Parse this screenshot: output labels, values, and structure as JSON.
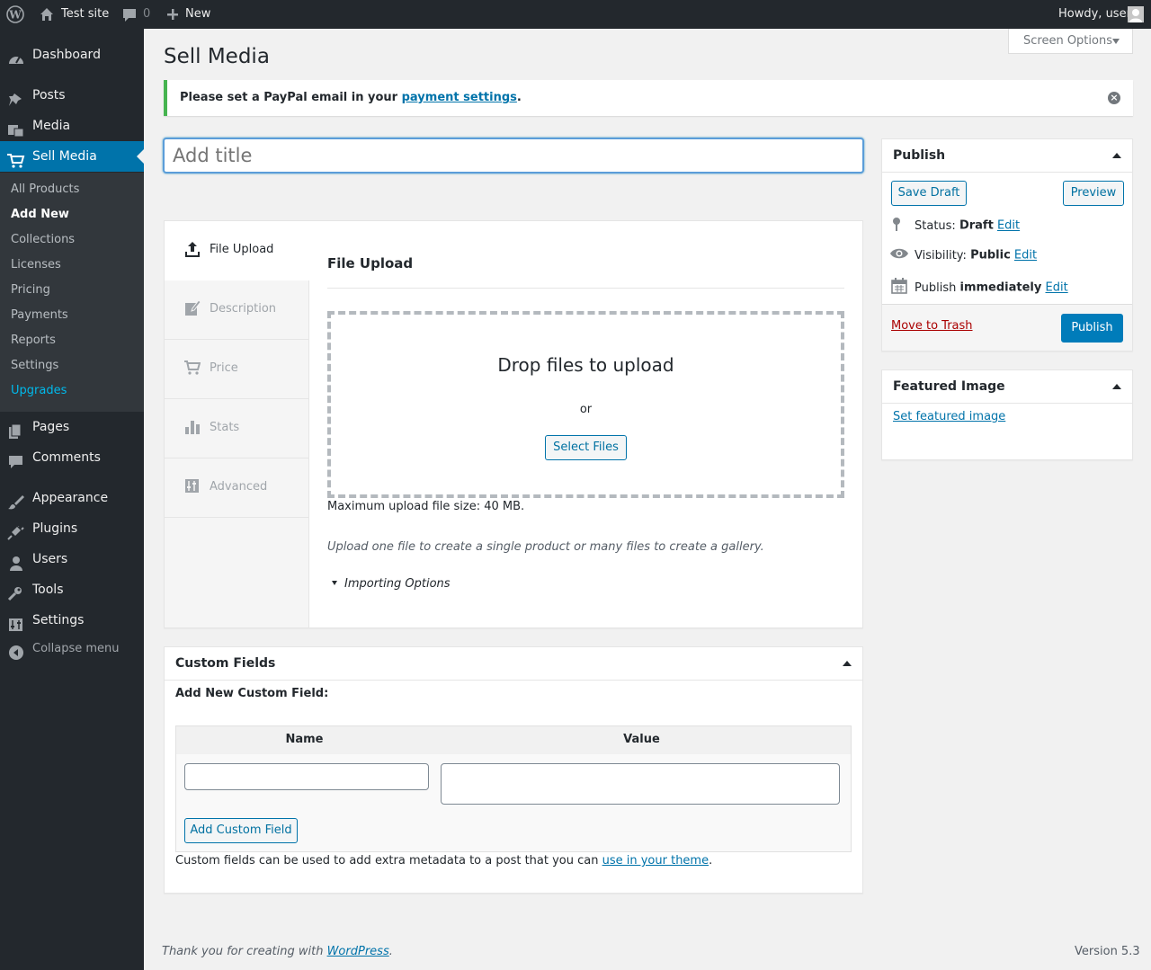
{
  "admin_bar": {
    "site_name": "Test site",
    "comments_count": "0",
    "new_label": "New",
    "greeting": "Howdy, user"
  },
  "sidebar": {
    "items": [
      {
        "label": "Dashboard",
        "icon": "dashboard-icon"
      },
      {
        "label": "Posts",
        "icon": "pin-icon"
      },
      {
        "label": "Media",
        "icon": "media-icon"
      },
      {
        "label": "Sell Media",
        "icon": "cart-icon"
      },
      {
        "label": "Pages",
        "icon": "page-icon"
      },
      {
        "label": "Comments",
        "icon": "comment-icon"
      },
      {
        "label": "Appearance",
        "icon": "brush-icon"
      },
      {
        "label": "Plugins",
        "icon": "plug-icon"
      },
      {
        "label": "Users",
        "icon": "user-icon"
      },
      {
        "label": "Tools",
        "icon": "wrench-icon"
      },
      {
        "label": "Settings",
        "icon": "settings-icon"
      }
    ],
    "submenu": [
      "All Products",
      "Add New",
      "Collections",
      "Licenses",
      "Pricing",
      "Payments",
      "Reports",
      "Settings",
      "Upgrades"
    ],
    "collapse_label": "Collapse menu"
  },
  "page": {
    "title": "Sell Media",
    "screen_options": "Screen Options",
    "notice_text": "Please set a PayPal email in your ",
    "notice_link": "payment settings",
    "notice_end": ".",
    "title_placeholder": "Add title"
  },
  "editor": {
    "tabs": [
      "File Upload",
      "Description",
      "Price",
      "Stats",
      "Advanced"
    ],
    "section_title": "File Upload",
    "drop_text": "Drop files to upload",
    "or_text": "or",
    "select_files": "Select Files",
    "max_size": "Maximum upload file size: 40 MB.",
    "help_text": "Upload one file to create a single product or many files to create a gallery.",
    "importing_options": "Importing Options"
  },
  "custom_fields": {
    "title": "Custom Fields",
    "add_new_label": "Add New Custom Field:",
    "col_name": "Name",
    "col_value": "Value",
    "add_button": "Add Custom Field",
    "help_text": "Custom fields can be used to add extra metadata to a post that you can ",
    "help_link": "use in your theme",
    "help_end": "."
  },
  "publish": {
    "title": "Publish",
    "save_draft": "Save Draft",
    "preview": "Preview",
    "status_label": "Status: ",
    "status_value": "Draft",
    "visibility_label": "Visibility: ",
    "visibility_value": "Public",
    "publish_label": "Publish ",
    "publish_value": "immediately",
    "edit": "Edit",
    "trash": "Move to Trash",
    "publish_button": "Publish"
  },
  "featured": {
    "title": "Featured Image",
    "link": "Set featured image"
  },
  "footer": {
    "thanks": "Thank you for creating with ",
    "wp_link": "WordPress",
    "thanks_end": ".",
    "version": "Version 5.3"
  },
  "colors": {
    "accent": "#0073aa",
    "sidebar": "#23282d",
    "notice_success": "#46b450",
    "upgrade": "#00b9eb"
  }
}
